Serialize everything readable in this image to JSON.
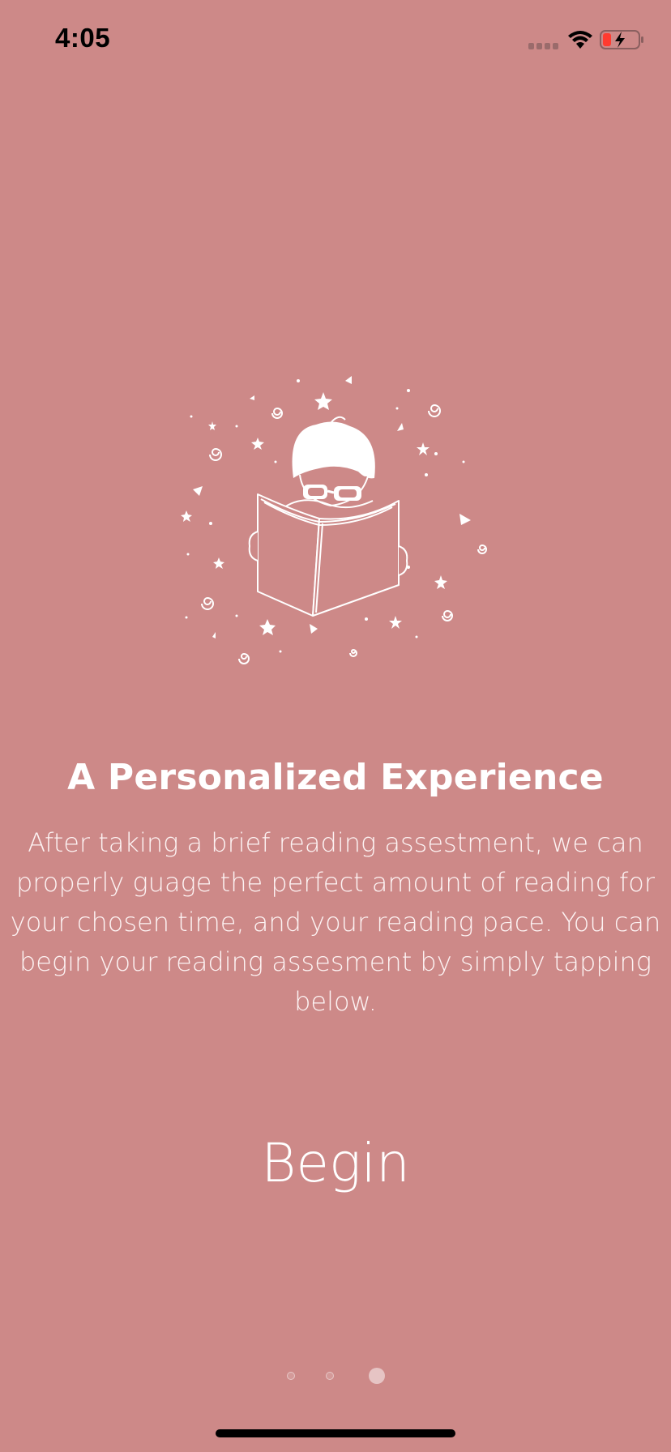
{
  "status_bar": {
    "time": "4:05",
    "icons": [
      "cellular-signal-icon",
      "wifi-icon",
      "battery-charging-icon"
    ],
    "battery_color": "#ff3b30"
  },
  "hero": {
    "illustration": "child-reading-book-illustration"
  },
  "content": {
    "title": "A Personalized Experience",
    "body": "After taking a brief reading assestment, we can properly guage the perfect amount of reading for your chosen time, and your reading pace. You can begin your reading assesment by simply tapping below."
  },
  "actions": {
    "begin_label": "Begin"
  },
  "pager": {
    "total_pages": 3,
    "current_page": 3
  },
  "colors": {
    "background": "#cd8988",
    "text": "#ffffff"
  }
}
